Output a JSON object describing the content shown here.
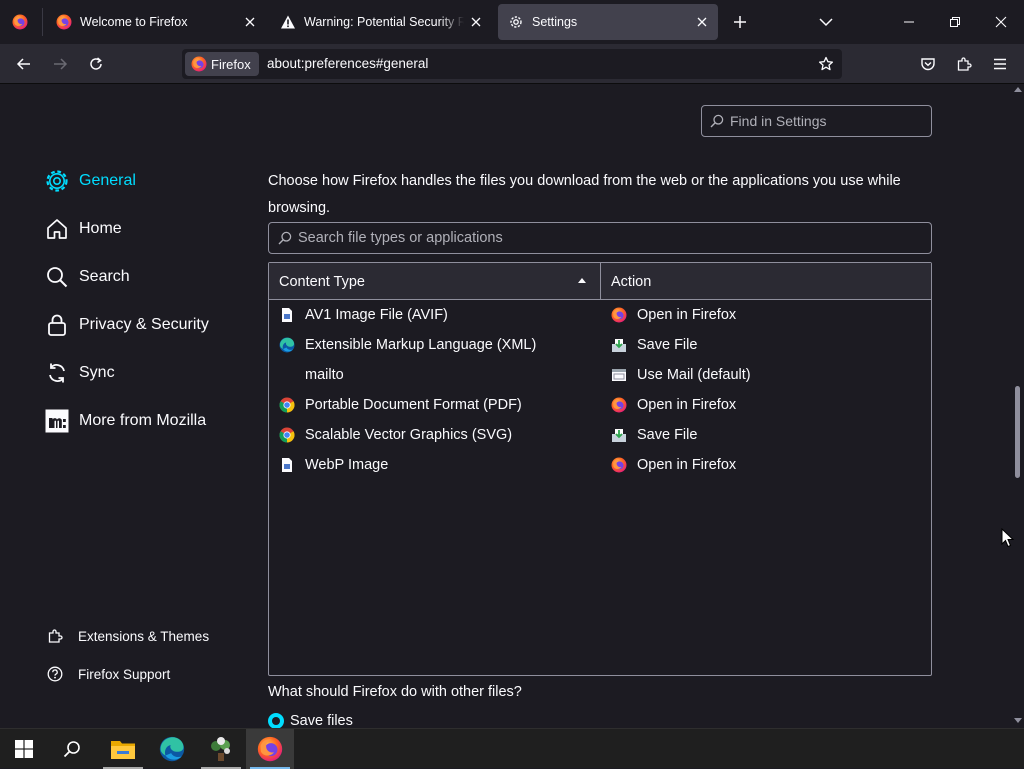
{
  "tabs": [
    {
      "title": "Welcome to Firefox",
      "icon": "firefox-icon",
      "selected": false
    },
    {
      "title": "Warning: Potential Security Risk Ahead",
      "icon": "warning-icon",
      "selected": false
    },
    {
      "title": "Settings",
      "icon": "gear-icon",
      "selected": true
    }
  ],
  "navbar": {
    "identity_label": "Firefox",
    "url": "about:preferences#general"
  },
  "settings": {
    "find_placeholder": "Find in Settings",
    "categories": [
      {
        "label": "General",
        "icon": "gear-icon",
        "active": true
      },
      {
        "label": "Home",
        "icon": "home-icon",
        "active": false
      },
      {
        "label": "Search",
        "icon": "search-icon",
        "active": false
      },
      {
        "label": "Privacy & Security",
        "icon": "lock-icon",
        "active": false
      },
      {
        "label": "Sync",
        "icon": "sync-icon",
        "active": false
      },
      {
        "label": "More from Mozilla",
        "icon": "mozilla-icon",
        "active": false
      }
    ],
    "footer_links": [
      {
        "label": "Extensions & Themes",
        "icon": "puzzle-icon"
      },
      {
        "label": "Firefox Support",
        "icon": "help-icon"
      }
    ],
    "applications": {
      "description": "Choose how Firefox handles the files you download from the web or the applications you use while browsing.",
      "filter_placeholder": "Search file types or applications",
      "columns": {
        "content_type": "Content Type",
        "action": "Action"
      },
      "rows": [
        {
          "type": "AV1 Image File (AVIF)",
          "type_icon": "file-icon",
          "action": "Open in Firefox",
          "action_icon": "firefox-icon"
        },
        {
          "type": "Extensible Markup Language (XML)",
          "type_icon": "edge-icon",
          "action": "Save File",
          "action_icon": "save-file-icon"
        },
        {
          "type": "mailto",
          "type_icon": "",
          "action": "Use Mail (default)",
          "action_icon": "mail-app-icon"
        },
        {
          "type": "Portable Document Format (PDF)",
          "type_icon": "chrome-icon",
          "action": "Open in Firefox",
          "action_icon": "firefox-icon"
        },
        {
          "type": "Scalable Vector Graphics (SVG)",
          "type_icon": "chrome-icon",
          "action": "Save File",
          "action_icon": "save-file-icon"
        },
        {
          "type": "WebP Image",
          "type_icon": "file-icon",
          "action": "Open in Firefox",
          "action_icon": "firefox-icon"
        }
      ],
      "other_files_question": "What should Firefox do with other files?",
      "save_files_label": "Save files"
    }
  },
  "taskbar": {
    "items": [
      {
        "name": "start-button",
        "icon": "windows-icon"
      },
      {
        "name": "taskbar-search-button",
        "icon": "search-icon"
      },
      {
        "name": "taskbar-file-explorer",
        "icon": "folder-icon"
      },
      {
        "name": "taskbar-edge",
        "icon": "edge-icon"
      },
      {
        "name": "taskbar-app",
        "icon": "plant-icon"
      },
      {
        "name": "taskbar-firefox",
        "icon": "firefox-icon",
        "active": true
      }
    ]
  },
  "colors": {
    "accent": "#00ddff",
    "background": "#1c1b22",
    "toolbar": "#2b2a33",
    "selected_tab": "#42414d"
  }
}
